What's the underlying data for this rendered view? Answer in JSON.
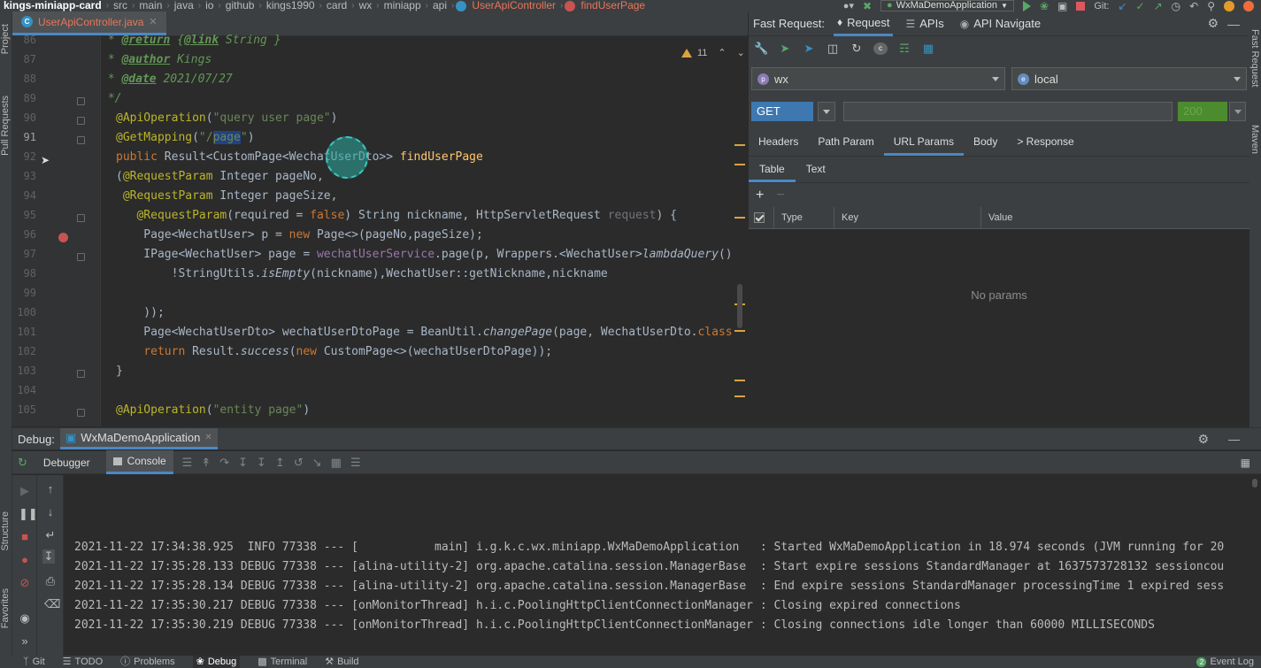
{
  "navbar": {
    "project": "kings-miniapp-card",
    "crumbs": [
      "src",
      "main",
      "java",
      "io",
      "github",
      "kings1990",
      "card",
      "wx",
      "miniapp",
      "api"
    ],
    "class_crumb": "UserApiController",
    "method_crumb": "findUserPage",
    "run_config": "WxMaDemoApplication",
    "git_label": "Git:"
  },
  "left_strip": {
    "project": "Project",
    "pull_requests": "Pull Requests",
    "structure": "Structure",
    "favorites": "Favorites"
  },
  "right_strip": {
    "fast_request": "Fast Request",
    "maven": "Maven"
  },
  "editor": {
    "tab_label": "UserApiController.java",
    "inspections_count": "11",
    "line_numbers": [
      "86",
      "87",
      "88",
      "89",
      "90",
      "91",
      "92",
      "93",
      "94",
      "95",
      "96",
      "97",
      "98",
      "99",
      "100",
      "101",
      "102",
      "103",
      "104",
      "105"
    ],
    "current_line": "91",
    "lines": {
      "l86a": " * ",
      "l86b": "@return",
      "l86c": " {",
      "l86d": "@link",
      "l86e": " String }",
      "l87a": " * ",
      "l87b": "@author",
      "l87c": " Kings",
      "l88a": " * ",
      "l88b": "@date",
      "l88c": " 2021/07/27",
      "l89": " */",
      "l90a": "@ApiOperation",
      "l90b": "(",
      "l90c": "\"query user page\"",
      "l90d": ")",
      "l91a": "@GetMapping",
      "l91b": "(",
      "l91c": "\"/",
      "l91d": "page",
      "l91e": "\"",
      "l91f": ")",
      "l92a": "public ",
      "l92b": "Result<CustomPage<WechatUserDto>> ",
      "l92c": "findUserPage",
      "l93a": "(",
      "l93b": "@RequestParam",
      "l93c": " Integer pageNo,",
      "l94a": " ",
      "l94b": "@RequestParam",
      "l94c": " Integer pageSize,",
      "l95a": "   ",
      "l95b": "@RequestParam",
      "l95c": "(required = ",
      "l95d": "false",
      "l95e": ") String nickname, HttpServletRequest ",
      "l95f": "request",
      "l95g": ") {",
      "l96a": "    Page<WechatUser> p = ",
      "l96b": "new",
      "l96c": " Page<>(pageNo,pageSize);",
      "l97a": "    IPage<WechatUser> page = ",
      "l97b": "wechatUserService",
      "l97c": ".page(p, Wrappers.<WechatUser>",
      "l97d": "lambdaQuery",
      "l97e": "()",
      "l98a": "        !StringUtils.",
      "l98b": "isEmpty",
      "l98c": "(nickname),WechatUser::getNickname,nickname",
      "l100": "    ));",
      "l101a": "    Page<WechatUserDto> wechatUserDtoPage = BeanUtil.",
      "l101b": "changePage",
      "l101c": "(page, WechatUserDto.",
      "l101d": "class",
      "l102a": "    ",
      "l102b": "return",
      "l102c": " Result.",
      "l102d": "success",
      "l102e": "(",
      "l102f": "new",
      "l102g": " CustomPage<>(wechatUserDtoPage));",
      "l103": "}",
      "l105a": "@ApiOperation",
      "l105b": "(",
      "l105c": "\"entity page\"",
      "l105d": ")"
    }
  },
  "fast_request": {
    "title": "Fast Request:",
    "tabs": [
      "Request",
      "APIs",
      "API Navigate"
    ],
    "project_select": {
      "badge": "p",
      "value": "wx"
    },
    "env_select": {
      "badge": "e",
      "value": "local"
    },
    "method": "GET",
    "url": "",
    "status_code": "200",
    "request_tabs": [
      "Headers",
      "Path Param",
      "URL Params",
      "Body",
      "> Response"
    ],
    "sub_tabs": [
      "Table",
      "Text"
    ],
    "add_label": "+",
    "remove_label": "−",
    "columns": [
      "Type",
      "Key",
      "Value"
    ],
    "empty_text": "No params"
  },
  "debug": {
    "title": "Debug:",
    "session": "WxMaDemoApplication",
    "tabs": [
      "Debugger",
      "Console"
    ],
    "log_lines": [
      "2021-11-22 17:34:38.925  INFO 77338 --- [           main] i.g.k.c.wx.miniapp.WxMaDemoApplication   : Started WxMaDemoApplication in 18.974 seconds (JVM running for 20",
      "2021-11-22 17:35:28.133 DEBUG 77338 --- [alina-utility-2] org.apache.catalina.session.ManagerBase  : Start expire sessions StandardManager at 1637573728132 sessioncou",
      "2021-11-22 17:35:28.134 DEBUG 77338 --- [alina-utility-2] org.apache.catalina.session.ManagerBase  : End expire sessions StandardManager processingTime 1 expired sess",
      "2021-11-22 17:35:30.217 DEBUG 77338 --- [onMonitorThread] h.i.c.PoolingHttpClientConnectionManager : Closing expired connections",
      "2021-11-22 17:35:30.219 DEBUG 77338 --- [onMonitorThread] h.i.c.PoolingHttpClientConnectionManager : Closing connections idle longer than 60000 MILLISECONDS"
    ]
  },
  "statusbar": {
    "items": [
      "Git",
      "TODO",
      "Problems",
      "Debug",
      "Terminal",
      "Build"
    ],
    "active": "Debug",
    "event_log_count": "2",
    "event_log": "Event Log"
  },
  "colors": {
    "accent": "#4a88c7",
    "annotation": "#bbb529",
    "keyword": "#cc7832",
    "string": "#6a8759",
    "method": "#ffc66d",
    "method_get": "#3e78b0",
    "status_ok": "#4c8c2e"
  }
}
